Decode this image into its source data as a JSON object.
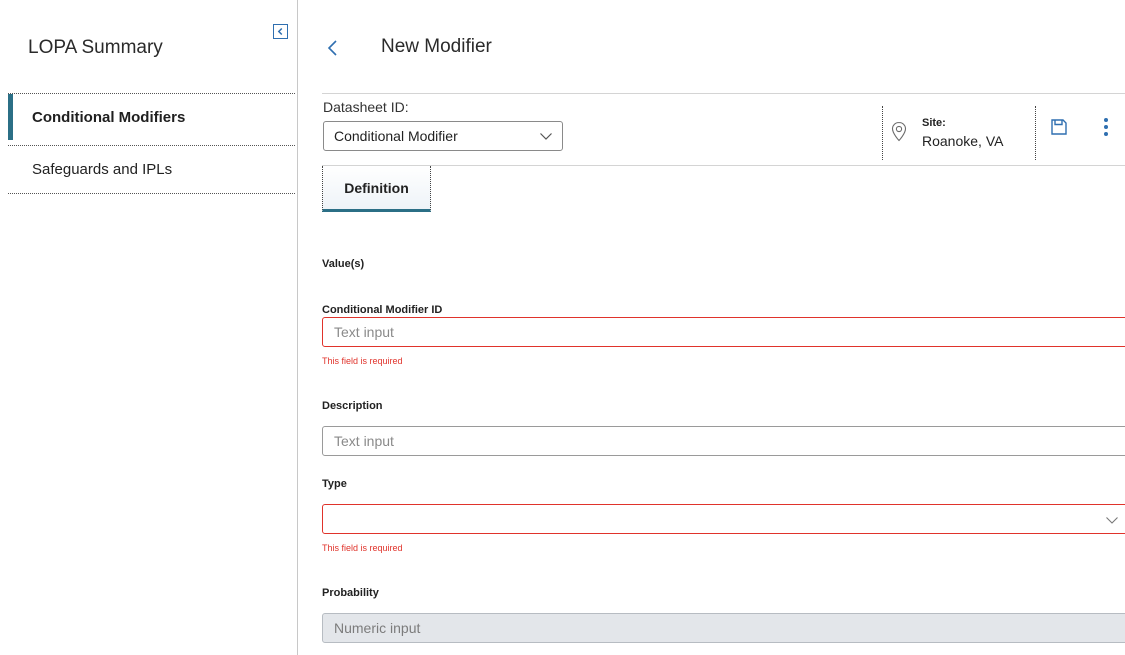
{
  "sidebar": {
    "title": "LOPA Summary",
    "items": [
      {
        "label": "Conditional Modifiers",
        "active": true
      },
      {
        "label": "Safeguards and IPLs",
        "active": false
      }
    ]
  },
  "header": {
    "title": "New Modifier",
    "datasheet_label": "Datasheet ID:",
    "datasheet_value": "Conditional Modifier",
    "site_label": "Site:",
    "site_value": "Roanoke, VA"
  },
  "tabs": [
    {
      "label": "Definition",
      "active": true
    }
  ],
  "form": {
    "section_label": "Value(s)",
    "fields": [
      {
        "label": "Conditional Modifier ID",
        "placeholder": "Text input",
        "error": "This field is required"
      },
      {
        "label": "Description",
        "placeholder": "Text input"
      },
      {
        "label": "Type",
        "value": "",
        "error": "This field is required"
      },
      {
        "label": "Probability",
        "placeholder": "Numeric input",
        "disabled": true
      }
    ]
  },
  "colors": {
    "accent": "#2b6f86",
    "error": "#e0332b",
    "icon_blue": "#2f6fb0"
  }
}
